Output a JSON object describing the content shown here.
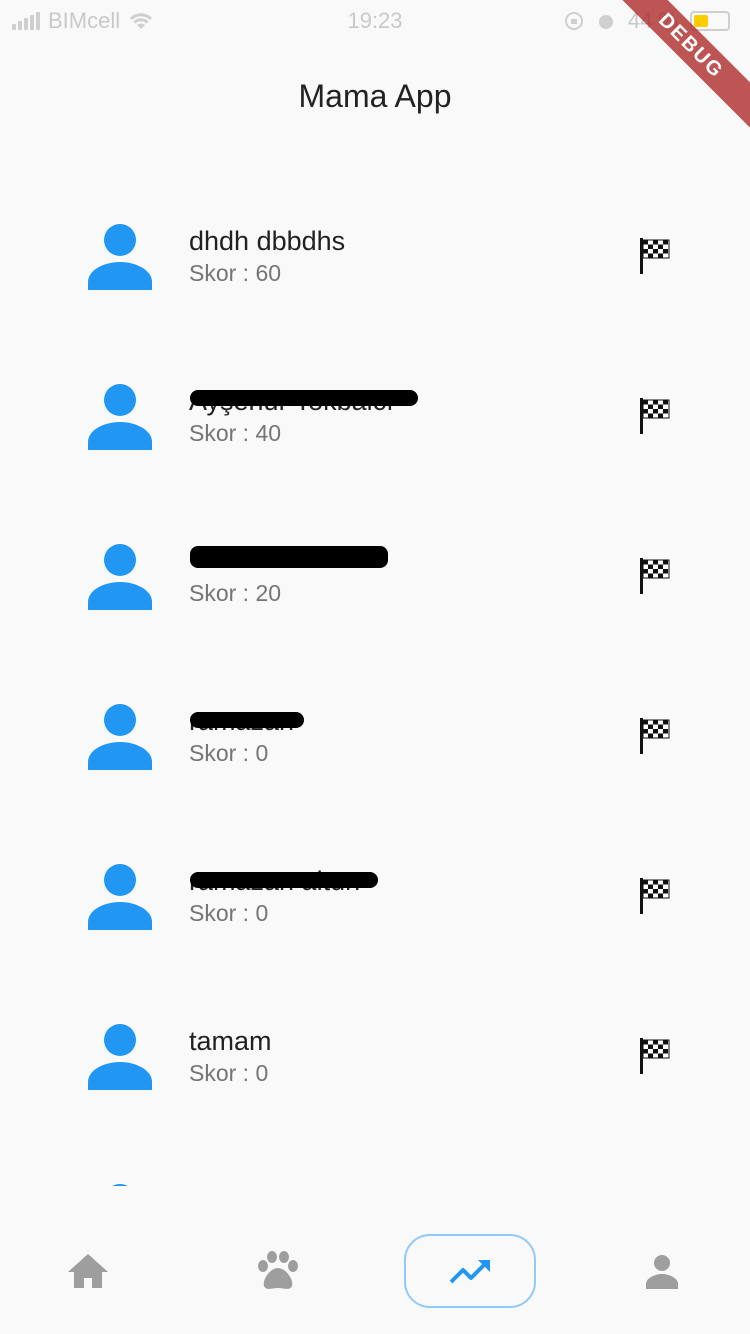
{
  "status_bar": {
    "carrier": "BIMcell",
    "time": "19:23",
    "battery_percent": "44 %"
  },
  "debug_banner": "DEBUG",
  "app_title": "Mama App",
  "score_prefix": "Skor : ",
  "users": [
    {
      "name": "dhdh dbbdhs",
      "score": "Skor : 60",
      "redacted": false
    },
    {
      "name": "Ayşenur Tokbalcı",
      "score": "Skor : 40",
      "redacted": true
    },
    {
      "name": "",
      "score": "Skor : 20",
      "redacted": true
    },
    {
      "name": "ramazan",
      "score": "Skor : 0",
      "redacted": true
    },
    {
      "name": "ramazan altun",
      "score": "Skor : 0",
      "redacted": true
    },
    {
      "name": "tamam",
      "score": "Skor : 0",
      "redacted": false
    }
  ],
  "colors": {
    "accent": "#2196F3",
    "nav_inactive": "#9E9E9E",
    "nav_active_border": "#90CAF9",
    "background": "#F9F9F9"
  },
  "bottom_nav": {
    "items": [
      {
        "icon": "home-icon",
        "active": false
      },
      {
        "icon": "paw-icon",
        "active": false
      },
      {
        "icon": "trending-up-icon",
        "active": true
      },
      {
        "icon": "person-icon",
        "active": false
      }
    ]
  }
}
